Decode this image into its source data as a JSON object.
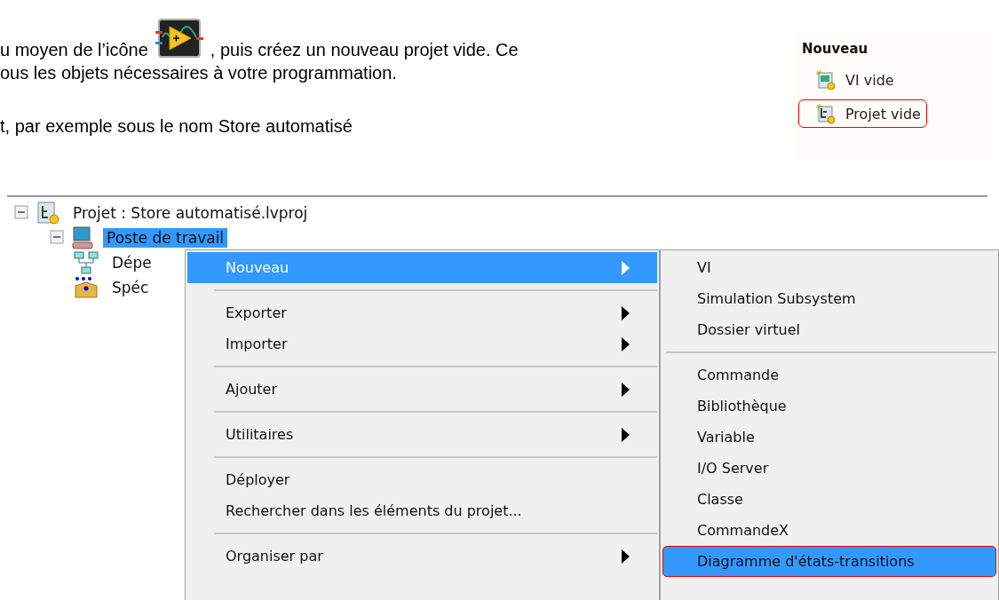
{
  "document": {
    "line_1_before_icon": "u moyen de l’icône",
    "line_1_after_icon": ", puis créez un nouveau projet vide. Ce",
    "line_2": "ous les objets nécessaires à votre programmation.",
    "line_3": "t, par exemple sous le nom Store automatisé"
  },
  "new_panel": {
    "title": "Nouveau",
    "items": [
      {
        "kind": "vi",
        "label": "VI vide",
        "outlined": false
      },
      {
        "kind": "project",
        "label": "Projet vide",
        "outlined": true
      }
    ]
  },
  "project_tree": {
    "items": [
      {
        "kind": "project",
        "label": "Projet : Store automatisé.lvproj",
        "expanded": true,
        "selected": false,
        "children": [
          {
            "kind": "computer",
            "label": "Poste de travail",
            "expanded": true,
            "selected": true,
            "children": [
              {
                "kind": "dependencies",
                "label": "Dépe",
                "selected": false
              },
              {
                "kind": "build",
                "label": "Spéc",
                "selected": false
              }
            ]
          }
        ]
      }
    ]
  },
  "context_menu": {
    "items": [
      {
        "kind": "item",
        "label": "Nouveau",
        "submenu": true,
        "selected": true
      },
      {
        "kind": "separator"
      },
      {
        "kind": "item",
        "label": "Exporter",
        "submenu": true,
        "selected": false
      },
      {
        "kind": "item",
        "label": "Importer",
        "submenu": true,
        "selected": false
      },
      {
        "kind": "separator"
      },
      {
        "kind": "item",
        "label": "Ajouter",
        "submenu": true,
        "selected": false
      },
      {
        "kind": "separator"
      },
      {
        "kind": "item",
        "label": "Utilitaires",
        "submenu": true,
        "selected": false
      },
      {
        "kind": "separator"
      },
      {
        "kind": "item",
        "label": "Déployer",
        "submenu": false,
        "selected": false
      },
      {
        "kind": "item",
        "label": "Rechercher dans les éléments du projet...",
        "submenu": false,
        "selected": false
      },
      {
        "kind": "separator"
      },
      {
        "kind": "item",
        "label": "Organiser par",
        "submenu": true,
        "selected": false
      }
    ]
  },
  "submenu": {
    "items": [
      {
        "kind": "item",
        "label": "VI",
        "selected": false,
        "outlined": false
      },
      {
        "kind": "item",
        "label": "Simulation Subsystem",
        "selected": false,
        "outlined": false
      },
      {
        "kind": "item",
        "label": "Dossier virtuel",
        "selected": false,
        "outlined": false
      },
      {
        "kind": "separator"
      },
      {
        "kind": "item",
        "label": "Commande",
        "selected": false,
        "outlined": false
      },
      {
        "kind": "item",
        "label": "Bibliothèque",
        "selected": false,
        "outlined": false
      },
      {
        "kind": "item",
        "label": "Variable",
        "selected": false,
        "outlined": false
      },
      {
        "kind": "item",
        "label": "I/O Server",
        "selected": false,
        "outlined": false
      },
      {
        "kind": "item",
        "label": "Classe",
        "selected": false,
        "outlined": false
      },
      {
        "kind": "item",
        "label": "CommandeX",
        "selected": false,
        "outlined": false
      },
      {
        "kind": "item",
        "label": "Diagramme d'états-transitions",
        "selected": true,
        "outlined": true
      }
    ]
  }
}
